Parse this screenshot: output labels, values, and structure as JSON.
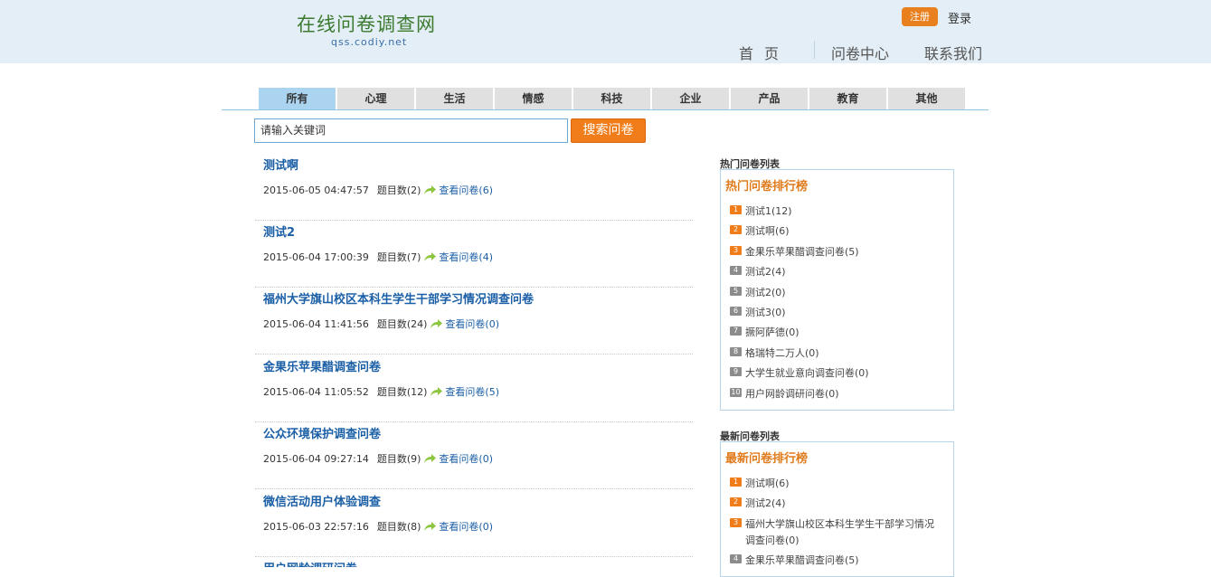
{
  "header": {
    "site_title": "在线问卷调查网",
    "site_url": "qss.codiy.net",
    "register": "注册",
    "login": "登录",
    "nav": {
      "home": "首页",
      "survey_center": "问卷中心",
      "contact": "联系我们"
    }
  },
  "tabs": [
    {
      "label": "所有",
      "active": true
    },
    {
      "label": "心理"
    },
    {
      "label": "生活"
    },
    {
      "label": "情感"
    },
    {
      "label": "科技"
    },
    {
      "label": "企业"
    },
    {
      "label": "产品"
    },
    {
      "label": "教育"
    },
    {
      "label": "其他"
    }
  ],
  "search": {
    "value": "请输入关键词",
    "button": "搜索问卷"
  },
  "surveys": [
    {
      "title": "测试啊",
      "date": "2015-06-05 04:47:57",
      "count": "题目数(2)",
      "link": "查看问卷(6)"
    },
    {
      "title": "测试2",
      "date": "2015-06-04 17:00:39",
      "count": "题目数(7)",
      "link": "查看问卷(4)"
    },
    {
      "title": "福州大学旗山校区本科生学生干部学习情况调查问卷",
      "date": "2015-06-04 11:41:56",
      "count": "题目数(24)",
      "link": "查看问卷(0)"
    },
    {
      "title": "金果乐苹果醋调查问卷",
      "date": "2015-06-04 11:05:52",
      "count": "题目数(12)",
      "link": "查看问卷(5)"
    },
    {
      "title": "公众环境保护调查问卷",
      "date": "2015-06-04 09:27:14",
      "count": "题目数(9)",
      "link": "查看问卷(0)"
    },
    {
      "title": "微信活动用户体验调查",
      "date": "2015-06-03 22:57:16",
      "count": "题目数(8)",
      "link": "查看问卷(0)"
    },
    {
      "title": "用户网龄调研问卷",
      "date": "",
      "count": "",
      "link": ""
    }
  ],
  "hot_panel": {
    "heading": "热门问卷列表",
    "title": "热门问卷排行榜",
    "items": [
      {
        "num": "1",
        "text": "测试1(12)"
      },
      {
        "num": "2",
        "text": "测试啊(6)"
      },
      {
        "num": "3",
        "text": "金果乐苹果醋调查问卷(5)"
      },
      {
        "num": "4",
        "text": "测试2(4)"
      },
      {
        "num": "5",
        "text": "测试2(0)"
      },
      {
        "num": "6",
        "text": "测试3(0)"
      },
      {
        "num": "7",
        "text": "撅阿萨德(0)"
      },
      {
        "num": "8",
        "text": "格瑞特二万人(0)"
      },
      {
        "num": "9",
        "text": "大学生就业意向调查问卷(0)"
      },
      {
        "num": "10",
        "text": "用户网龄调研问卷(0)"
      }
    ]
  },
  "new_panel": {
    "heading": "最新问卷列表",
    "title": "最新问卷排行榜",
    "items": [
      {
        "num": "1",
        "text": "测试啊(6)"
      },
      {
        "num": "2",
        "text": "测试2(4)"
      },
      {
        "num": "3",
        "text": "福州大学旗山校区本科生学生干部学习情况\n调查问卷(0)"
      },
      {
        "num": "4",
        "text": "金果乐苹果醋调查问卷(5)"
      }
    ]
  },
  "colors": {
    "accent": "#f07c1a",
    "link": "#1b5fa6",
    "header_bg": "#e3eef6",
    "active_tab": "#aad4f0"
  }
}
